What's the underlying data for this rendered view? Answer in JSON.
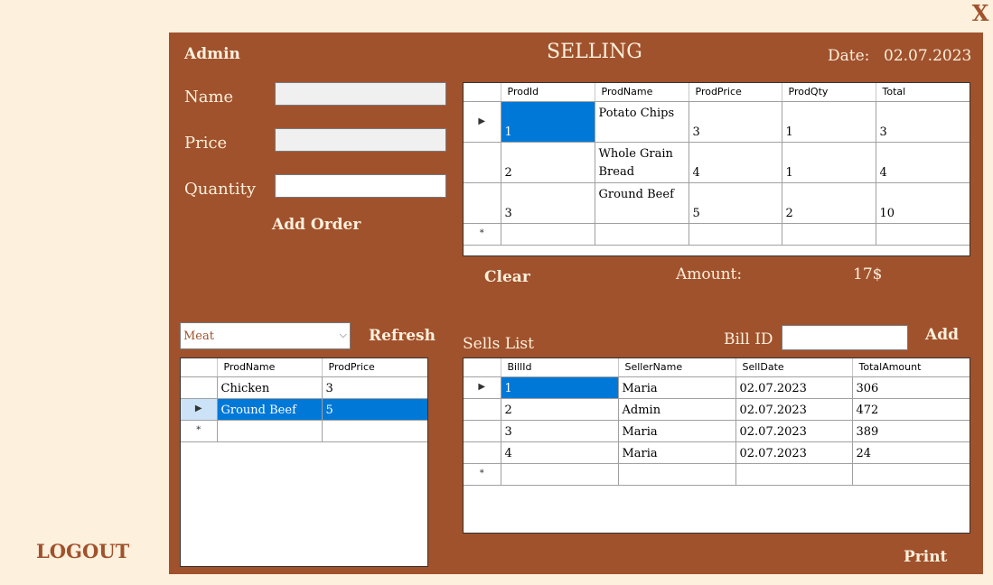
{
  "window": {
    "close_label": "X",
    "logout_label": "LOGOUT"
  },
  "header": {
    "user": "Admin",
    "title": "SELLING",
    "date_label": "Date:",
    "date_value": "02.07.2023"
  },
  "form": {
    "name_label": "Name",
    "price_label": "Price",
    "quantity_label": "Quantity",
    "name_value": "",
    "price_value": "",
    "quantity_value": "",
    "add_order_label": "Add Order"
  },
  "order": {
    "columns": [
      "ProdId",
      "ProdName",
      "ProdPrice",
      "ProdQty",
      "Total"
    ],
    "rows": [
      [
        "1",
        "Potato Chips",
        "3",
        "1",
        "3"
      ],
      [
        "2",
        "Whole Grain Bread",
        "4",
        "1",
        "4"
      ],
      [
        "3",
        "Ground Beef",
        "5",
        "2",
        "10"
      ]
    ],
    "clear_label": "Clear",
    "amount_label": "Amount:",
    "amount_value": "17$"
  },
  "category": {
    "selected": "Meat",
    "refresh_label": "Refresh"
  },
  "products": {
    "columns": [
      "ProdName",
      "ProdPrice"
    ],
    "rows": [
      [
        "Chicken",
        "3"
      ],
      [
        "Ground Beef",
        "5"
      ]
    ]
  },
  "sells": {
    "label": "Sells List",
    "bill_id_label": "Bill ID",
    "bill_id_value": "",
    "add_label": "Add",
    "columns": [
      "BillId",
      "SellerName",
      "SellDate",
      "TotalAmount"
    ],
    "rows": [
      [
        "1",
        "Maria",
        "02.07.2023",
        "306"
      ],
      [
        "2",
        "Admin",
        "02.07.2023",
        "472"
      ],
      [
        "3",
        "Maria",
        "02.07.2023",
        "389"
      ],
      [
        "4",
        "Maria",
        "02.07.2023",
        "24"
      ]
    ],
    "print_label": "Print"
  },
  "glyphs": {
    "current_row": "▶",
    "new_row": "*",
    "dropdown": "⌵"
  }
}
